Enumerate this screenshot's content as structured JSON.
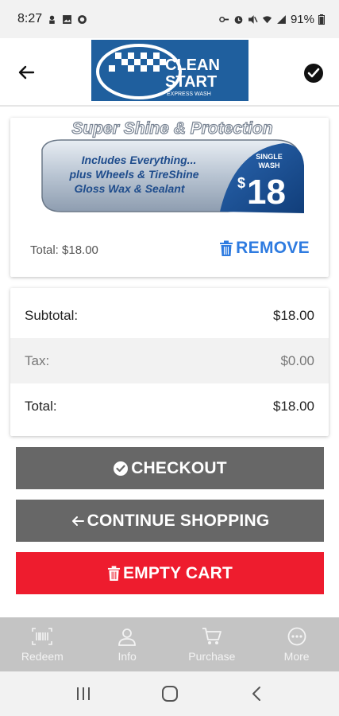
{
  "status_bar": {
    "time": "8:27",
    "battery": "91%"
  },
  "header": {
    "logo_line1": "CLEAN",
    "logo_line2": "START",
    "logo_line3": "EXPRESS WASH"
  },
  "cart": {
    "product": {
      "title": "Super Shine & Protection",
      "desc_line1": "Includes Everything...",
      "desc_line2": "plus Wheels & TireShine",
      "desc_line3": "Gloss Wax & Sealant",
      "badge_line1": "SINGLE",
      "badge_line2": "WASH",
      "price_symbol": "$",
      "price": "18"
    },
    "item_total": "Total: $18.00",
    "remove_label": "REMOVE"
  },
  "totals": {
    "subtotal_label": "Subtotal:",
    "subtotal_value": "$18.00",
    "tax_label": "Tax:",
    "tax_value": "$0.00",
    "total_label": "Total:",
    "total_value": "$18.00"
  },
  "actions": {
    "checkout_label": "CHECKOUT",
    "continue_label": "CONTINUE SHOPPING",
    "empty_label": "EMPTY CART"
  },
  "bottom_nav": {
    "items": [
      {
        "label": "Redeem",
        "icon": "barcode-icon"
      },
      {
        "label": "Info",
        "icon": "person-icon"
      },
      {
        "label": "Purchase",
        "icon": "cart-icon"
      },
      {
        "label": "More",
        "icon": "more-icon"
      }
    ]
  },
  "colors": {
    "accent_blue": "#2e7be0",
    "danger_red": "#ee1c2e",
    "button_gray": "#676767",
    "logo_blue": "#1f5f9e"
  }
}
